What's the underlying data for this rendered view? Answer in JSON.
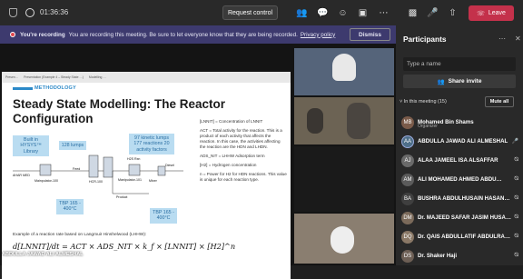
{
  "topbar": {
    "timer": "01:36:36",
    "request_control": "Request control",
    "leave": "Leave"
  },
  "banner": {
    "title": "You're recording",
    "message": "You are recording this meeting. Be sure to let everyone know that they are being recorded.",
    "link": "Privacy policy",
    "dismiss": "Dismiss"
  },
  "slide": {
    "strip_tabs": [
      "Presen…",
      "Presentation (Example 4 – Steady State …)",
      "Modelling …"
    ],
    "section": "METHODOLOGY",
    "title": "Steady State Modelling: The Reactor Configuration",
    "callouts": {
      "hysys": "Built in HYSYS™ Library",
      "lumps128": "128 lumps",
      "kinetic": "97 kinetic lumps 177 reactions 20 activity factors",
      "tbp1": "TBP 165 - 400°C",
      "tbp2": "TBP 165 - 400°C"
    },
    "flow_labels": [
      "AHAR MED",
      "Mainpulator-100",
      "Feed",
      "HCR-100",
      "Manipulator-101",
      "H2S Rxn",
      "Diesel",
      "Mixer",
      "Product"
    ],
    "note": "Example of a reaction rate based on Langmuir Hinshelwood (LHHW):",
    "equation": "d[LNNIT]/dt = ACT × ADS_NIT × k_f × [LNNIT] × [H2]^n",
    "defs": [
      "[LNNIT] = Concentration of LNNIT",
      "ACT = Total activity for the reaction. This is a product of each activity that affects the reaction. In this case, the activities affecting the reaction are the HDN and LHDN.",
      "ADS_NIT = LHHW Adsorption term",
      "[H2] = Hydrogen concentration",
      "n = Power for H2 for HDN reactions. This value is unique for each reaction type."
    ],
    "presenter": "ABDULLA JAWAD ALI ALMESHAL"
  },
  "panel": {
    "title": "Participants",
    "search_placeholder": "Type a name",
    "share_invite": "Share invite",
    "section_label": "In this meeting (15)",
    "mute_all": "Mute all",
    "participants": [
      {
        "name": "Mohamed Bin Shams",
        "role": "Organizer",
        "initials": "MB"
      },
      {
        "name": "ABDULLA JAWAD ALI ALMESHAL",
        "role": "",
        "initials": "AA"
      },
      {
        "name": "ALAA JAMEEL ISA ALSAFFAR",
        "role": "",
        "initials": "AJ"
      },
      {
        "name": "ALI MOHAMED AHMED ABDU…",
        "role": "",
        "initials": "AM"
      },
      {
        "name": "BUSHRA ABDULHUSAIN HASAN…",
        "role": "",
        "initials": "BA"
      },
      {
        "name": "Dr. MAJEED SAFAR JASIM HUSA…",
        "role": "",
        "initials": "DM"
      },
      {
        "name": "Dr. QAIS ABDULLATIF ABDULRA…",
        "role": "",
        "initials": "DQ"
      },
      {
        "name": "Dr. Shaker Haji",
        "role": "",
        "initials": "DS"
      }
    ]
  }
}
